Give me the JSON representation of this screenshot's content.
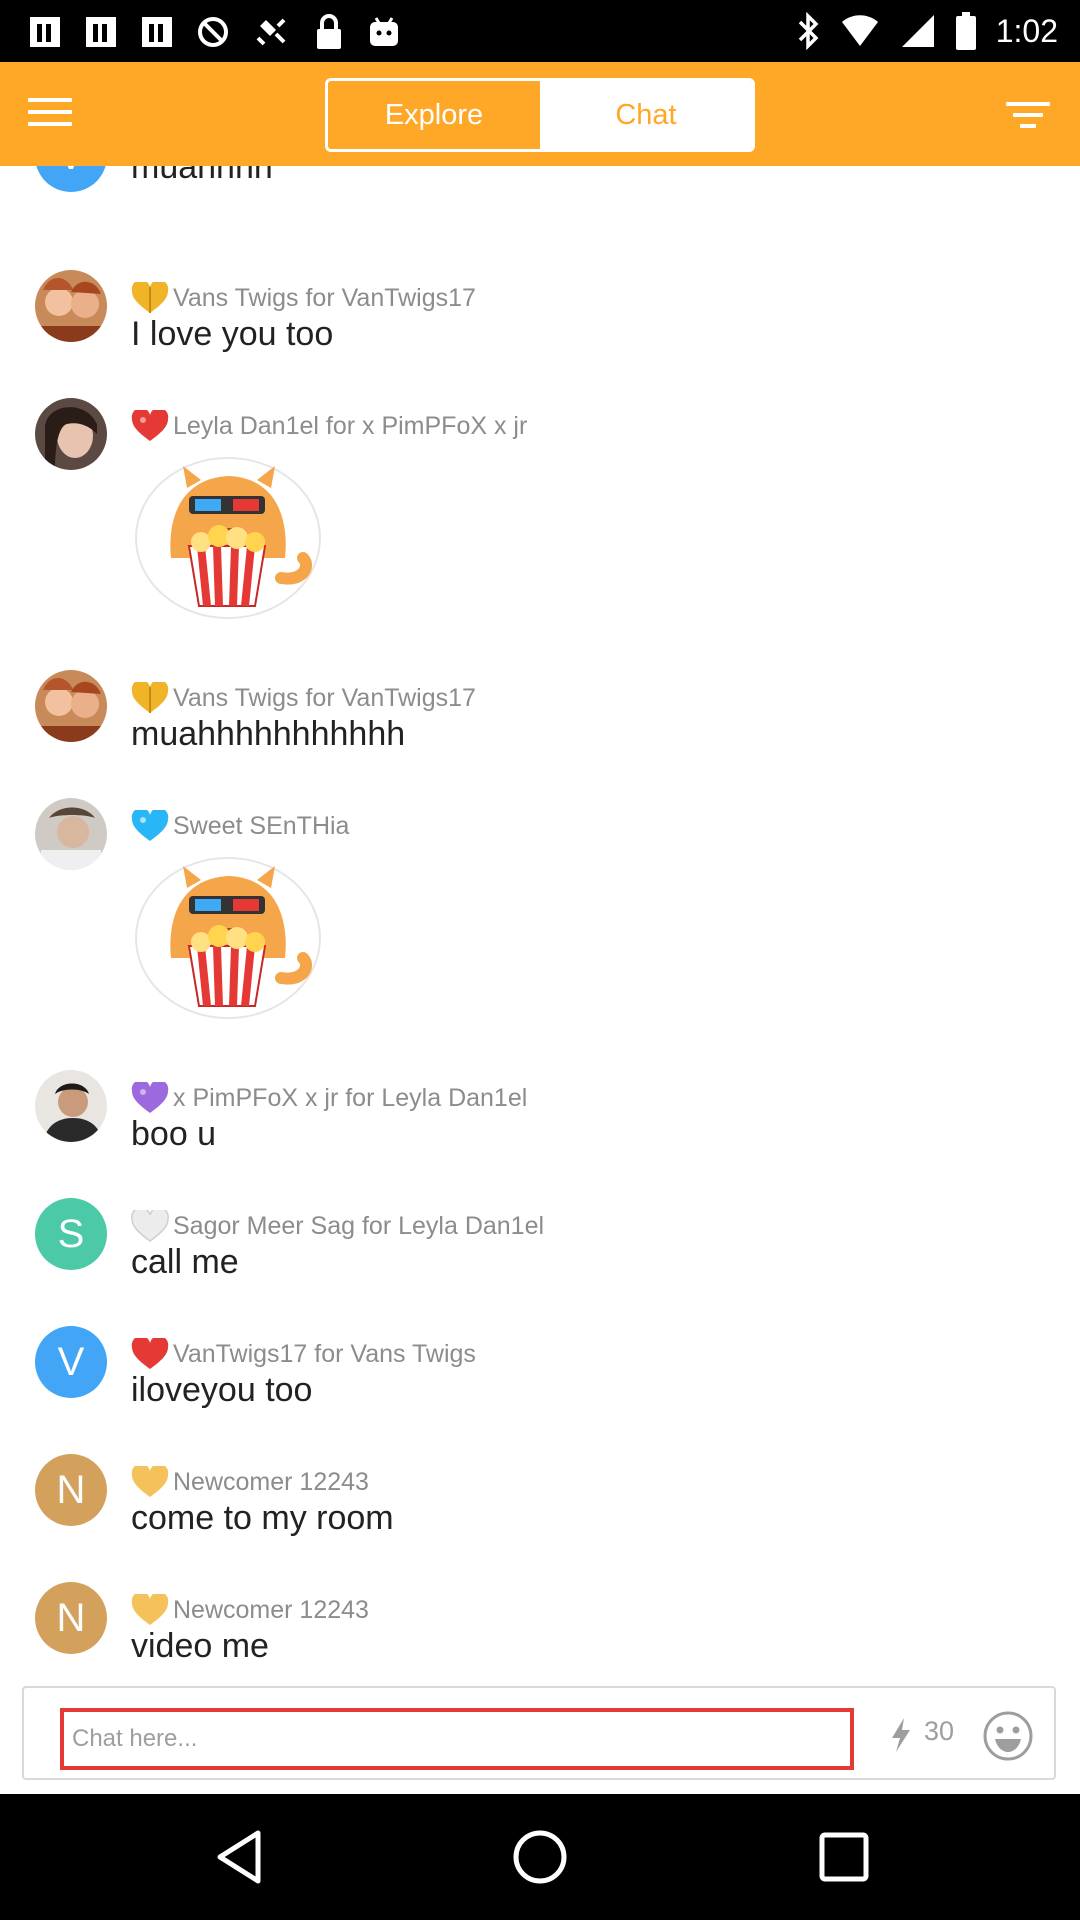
{
  "status_bar": {
    "time": "1:02"
  },
  "header": {
    "tabs": [
      {
        "label": "Explore",
        "active": false
      },
      {
        "label": "Chat",
        "active": true
      }
    ],
    "accent_color": "#FFA726"
  },
  "messages": [
    {
      "avatar_letter": "V",
      "avatar_color": "#42A5F5",
      "heart_color": "#E53935",
      "sender": "",
      "text": "muahhhh"
    },
    {
      "avatar": "photo",
      "heart_color": "#F0B429",
      "sender": "Vans Twigs for VanTwigs17",
      "text": "I love you too"
    },
    {
      "avatar": "photo",
      "heart_color": "#E53935",
      "sender": "Leyla Dan1el for x PimPFoX x jr",
      "sticker": "popcorn-cat-sticker"
    },
    {
      "avatar": "photo",
      "heart_color": "#F0B429",
      "sender": "Vans Twigs for VanTwigs17",
      "text": "muahhhhhhhhhhh"
    },
    {
      "avatar": "photo",
      "heart_color": "#29B6F6",
      "sender": "Sweet SEnTHia",
      "sticker": "popcorn-cat-sticker"
    },
    {
      "avatar": "photo",
      "heart_color": "#9C6ADE",
      "sender": "x PimPFoX x jr for Leyla Dan1el",
      "text": "boo u"
    },
    {
      "avatar_letter": "S",
      "avatar_color": "#4CC9A7",
      "heart_color": "#E0E0E0",
      "sender": "Sagor Meer Sag for Leyla Dan1el",
      "text": "call me"
    },
    {
      "avatar_letter": "V",
      "avatar_color": "#42A5F5",
      "heart_color": "#E53935",
      "sender": "VanTwigs17 for Vans Twigs",
      "text": "iloveyou too"
    },
    {
      "avatar_letter": "N",
      "avatar_color": "#D4A15C",
      "heart_color": "#F5C15A",
      "sender": "Newcomer 12243",
      "text": "come to my room"
    },
    {
      "avatar_letter": "N",
      "avatar_color": "#D4A15C",
      "heart_color": "#F5C15A",
      "sender": "Newcomer 12243",
      "text": "video me"
    }
  ],
  "input": {
    "placeholder": "Chat here...",
    "value": "",
    "count": "30"
  },
  "icons": {
    "menu": "hamburger-menu-icon",
    "filter": "filter-icon",
    "bolt": "lightning-bolt-icon",
    "emoji": "smiley-emoji-icon",
    "nav": [
      "back-icon",
      "home-icon",
      "recents-icon"
    ]
  }
}
